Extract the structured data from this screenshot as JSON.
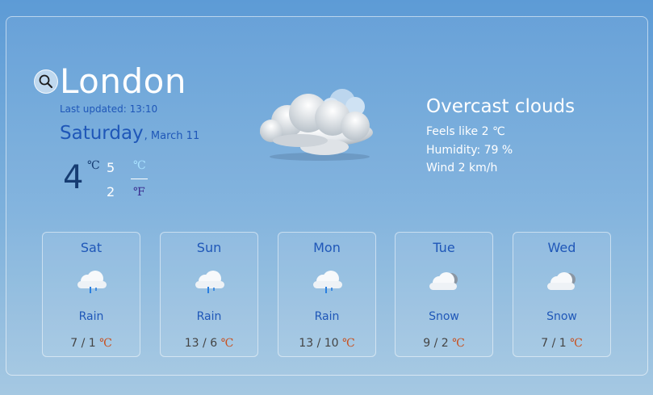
{
  "current": {
    "city": "London",
    "last_updated": "Last updated: 13:10",
    "day_name": "Saturday",
    "date": ", March 11",
    "temperature": "4",
    "temp_unit": "℃",
    "temp_max": "5",
    "temp_min": "2",
    "unit_celsius": "℃",
    "unit_fahrenheit": "℉",
    "condition": "Overcast clouds",
    "feels_like": "Feels like 2 ℃",
    "humidity": "Humidity: 79 %",
    "wind": "Wind 2 km/h",
    "icon": "overcast-clouds-icon"
  },
  "forecast": [
    {
      "day": "Sat",
      "condition": "Rain",
      "high": "7",
      "low": "1",
      "unit": "℃",
      "icon": "rain-cloud-icon"
    },
    {
      "day": "Sun",
      "condition": "Rain",
      "high": "13",
      "low": "6",
      "unit": "℃",
      "icon": "rain-cloud-icon"
    },
    {
      "day": "Mon",
      "condition": "Rain",
      "high": "13",
      "low": "10",
      "unit": "℃",
      "icon": "rain-cloud-icon"
    },
    {
      "day": "Tue",
      "condition": "Snow",
      "high": "9",
      "low": "2",
      "unit": "℃",
      "icon": "snow-cloud-icon"
    },
    {
      "day": "Wed",
      "condition": "Snow",
      "high": "7",
      "low": "1",
      "unit": "℃",
      "icon": "snow-cloud-icon"
    }
  ],
  "temp_separator": " / ",
  "colors": {
    "accent_blue": "#1f57b8",
    "temp_dark": "#163c72",
    "unit_orange": "#c8501e",
    "unit_celsius_active": "#a9e2ff",
    "unit_fahrenheit": "#3a2c8f"
  }
}
